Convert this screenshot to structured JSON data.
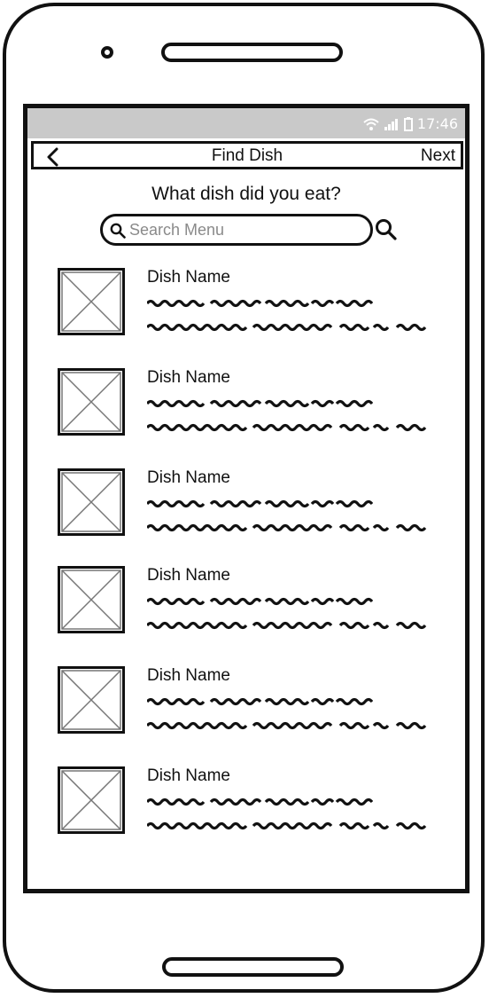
{
  "status_bar": {
    "time": "17:46"
  },
  "nav": {
    "back_icon": "chevron-left-icon",
    "title": "Find Dish",
    "next_label": "Next"
  },
  "prompt": "What dish did you eat?",
  "search": {
    "placeholder": "Search Menu",
    "value": "",
    "icon": "search-icon"
  },
  "dishes": [
    {
      "name": "Dish Name",
      "image": "image-placeholder-icon"
    },
    {
      "name": "Dish Name",
      "image": "image-placeholder-icon"
    },
    {
      "name": "Dish Name",
      "image": "image-placeholder-icon"
    },
    {
      "name": "Dish Name",
      "image": "image-placeholder-icon"
    },
    {
      "name": "Dish Name",
      "image": "image-placeholder-icon"
    },
    {
      "name": "Dish Name",
      "image": "image-placeholder-icon"
    }
  ]
}
